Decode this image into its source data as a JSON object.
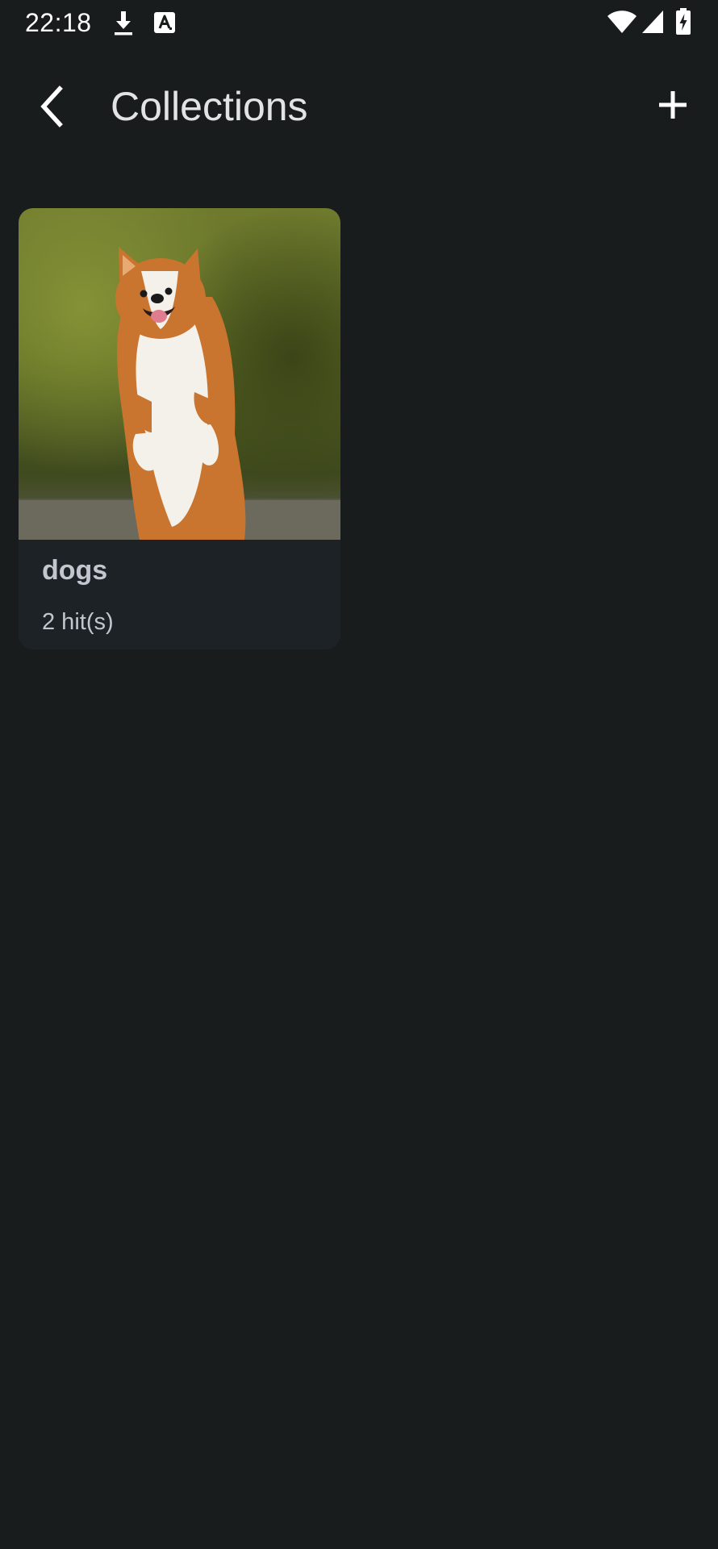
{
  "status_bar": {
    "time": "22:18",
    "icons": [
      "download-icon",
      "text-recognition-icon",
      "wifi-icon",
      "signal-icon",
      "battery-charging-icon"
    ]
  },
  "app_bar": {
    "title": "Collections",
    "back_icon": "chevron-left-icon",
    "add_icon": "plus-icon"
  },
  "collections": [
    {
      "name": "dogs",
      "count_text": "2 hit(s)",
      "thumbnail": "corgi-dog-photo"
    }
  ],
  "colors": {
    "background": "#191c1d",
    "card_background": "#1d2226",
    "title_text": "#e2e3e3",
    "card_text": "#c4c6cf"
  }
}
